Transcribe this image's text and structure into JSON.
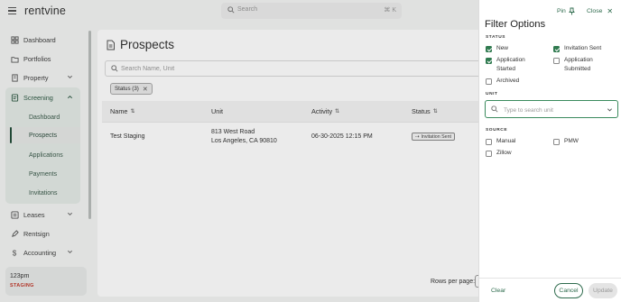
{
  "brand": {
    "logo_text": "rentvine",
    "accent": "#2f7a4f"
  },
  "topbar": {
    "search_placeholder": "Search",
    "shortcut": "⌘ K"
  },
  "sidebar": {
    "items": [
      {
        "label": "Dashboard",
        "icon": "dashboard-icon"
      },
      {
        "label": "Portfolios",
        "icon": "portfolio-icon"
      },
      {
        "label": "Property",
        "icon": "building-icon"
      },
      {
        "label": "Screening",
        "icon": "screening-icon"
      },
      {
        "label": "Leases",
        "icon": "lease-icon"
      },
      {
        "label": "Rentsign",
        "icon": "rentsign-icon"
      },
      {
        "label": "Accounting",
        "icon": "dollar-icon"
      }
    ],
    "screening_sub": [
      "Dashboard",
      "Prospects",
      "Applications",
      "Payments",
      "Invitations"
    ],
    "active_sub": "Prospects",
    "user": {
      "name": "123pm",
      "env": "STAGING"
    }
  },
  "main": {
    "title": "Prospects",
    "search_placeholder": "Search Name, Unit",
    "filter_chip": "Status (3)",
    "columns": [
      "Name",
      "Unit",
      "Activity",
      "Status"
    ],
    "rows": [
      {
        "name": "Test Staging",
        "unit_line1": "813 West Road",
        "unit_line2": "Los Angeles, CA 90810",
        "activity": "06-30-2025 12:15 PM",
        "status": "Invitation Sent"
      }
    ],
    "rows_per_page_label": "Rows per page:"
  },
  "filter": {
    "pin_label": "Pin",
    "close_label": "Close",
    "title": "Filter Options",
    "status_label": "STATUS",
    "status_options": [
      {
        "label": "New",
        "checked": true
      },
      {
        "label": "Invitation Sent",
        "checked": true
      },
      {
        "label": "Application Started",
        "line1": "Application",
        "line2": "Started",
        "checked": true
      },
      {
        "label": "Application Submitted",
        "line1": "Application",
        "line2": "Submitted",
        "checked": false
      },
      {
        "label": "Archived",
        "checked": false
      }
    ],
    "unit_label": "UNIT",
    "unit_placeholder": "Type to search unit",
    "source_label": "SOURCE",
    "source_options": [
      {
        "label": "Manual",
        "checked": false
      },
      {
        "label": "PMW",
        "checked": false
      },
      {
        "label": "Zillow",
        "checked": false
      }
    ],
    "clear_label": "Clear",
    "cancel_label": "Cancel",
    "update_label": "Update"
  }
}
